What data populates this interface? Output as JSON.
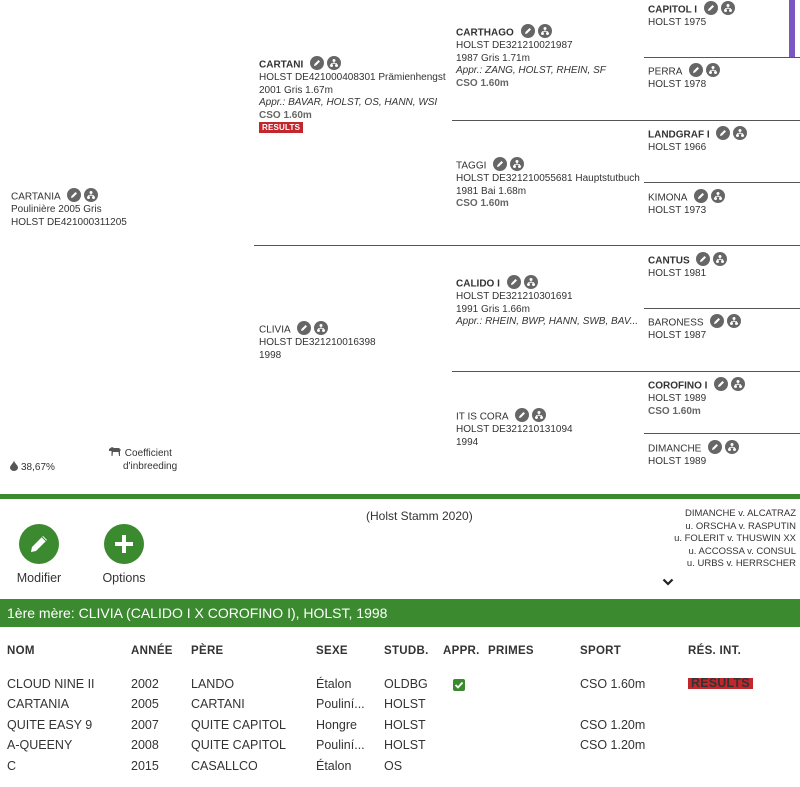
{
  "pedigree": {
    "gen1": {
      "name": "CARTANIA",
      "line1": "Poulinière 2005 Gris",
      "line2": "HOLST DE421000311205"
    },
    "gen2": [
      {
        "name": "CARTANI",
        "line1": "HOLST DE421000408301 Prämienhengst",
        "line2": "2001 Gris 1.67m",
        "appr": "Appr.: BAVAR, HOLST, OS, HANN, WSI",
        "sport": "CSO 1.60m",
        "badge": "RESULTS"
      },
      {
        "name": "CLIVIA",
        "line1": "HOLST DE321210016398",
        "line2": "1998"
      }
    ],
    "gen3": [
      {
        "name": "CARTHAGO",
        "line1": "HOLST DE321210021987",
        "line2": "1987 Gris 1.71m",
        "appr": "Appr.: ZANG, HOLST, RHEIN, SF",
        "sport": "CSO 1.60m"
      },
      {
        "name": "TAGGI",
        "line1": "HOLST DE321210055681 Hauptstutbuch",
        "line2": "1981 Bai 1.68m",
        "sport": "CSO 1.60m"
      },
      {
        "name": "CALIDO I",
        "line1": "HOLST DE321210301691",
        "line2": "1991 Gris 1.66m",
        "appr": "Appr.: RHEIN, BWP, HANN, SWB, BAV..."
      },
      {
        "name": "IT IS CORA",
        "line1": "HOLST DE321210131094",
        "line2": "1994"
      }
    ],
    "gen4": [
      {
        "name": "CAPITOL I",
        "line1": "HOLST 1975"
      },
      {
        "name": "PERRA",
        "line1": "HOLST 1978"
      },
      {
        "name": "LANDGRAF I",
        "line1": "HOLST 1966"
      },
      {
        "name": "KIMONA",
        "line1": "HOLST 1973"
      },
      {
        "name": "CANTUS",
        "line1": "HOLST 1981"
      },
      {
        "name": "BARONESS",
        "line1": "HOLST 1987"
      },
      {
        "name": "COROFINO I",
        "line1": "HOLST 1989",
        "sport": "CSO 1.60m"
      },
      {
        "name": "DIMANCHE",
        "line1": "HOLST 1989"
      }
    ],
    "inbreeding": {
      "percent": "38,67%",
      "label1": "Coefficient",
      "label2": "d'inbreeding"
    }
  },
  "actions": {
    "modify_label": "Modifier",
    "options_label": "Options"
  },
  "stamm": "(Holst Stamm 2020)",
  "lineage": [
    "DIMANCHE v. ALCATRAZ",
    "u. ORSCHA v. RASPUTIN",
    "u. FOLERIT v. THUSWIN XX",
    "u. ACCOSSA v. CONSUL",
    "u. URBS v. HERRSCHER"
  ],
  "mother_bar": "1ère mère: CLIVIA (CALIDO I X COROFINO I), HOLST, 1998",
  "table": {
    "headers": {
      "nom": "NOM",
      "annee": "ANNÉE",
      "pere": "PÈRE",
      "sexe": "SEXE",
      "studb": "STUDB.",
      "appr": "APPR.",
      "primes": "PRIMES",
      "sport": "SPORT",
      "res": "RÉS. INT."
    },
    "rows": [
      {
        "nom": "CLOUD NINE II",
        "annee": "2002",
        "pere": "LANDO",
        "sexe": "Étalon",
        "studb": "OLDBG",
        "appr": true,
        "sport": "CSO 1.60m",
        "res": "RESULTS"
      },
      {
        "nom": "CARTANIA",
        "annee": "2005",
        "pere": "CARTANI",
        "sexe": "Pouliní...",
        "studb": "HOLST",
        "appr": false,
        "sport": "",
        "res": ""
      },
      {
        "nom": "QUITE EASY 9",
        "annee": "2007",
        "pere": "QUITE CAPITOL",
        "sexe": "Hongre",
        "studb": "HOLST",
        "appr": false,
        "sport": "CSO 1.20m",
        "res": ""
      },
      {
        "nom": "A-QUEENY",
        "annee": "2008",
        "pere": "QUITE CAPITOL",
        "sexe": "Pouliní...",
        "studb": "HOLST",
        "appr": false,
        "sport": "CSO 1.20m",
        "res": ""
      },
      {
        "nom": "C",
        "annee": "2015",
        "pere": "CASALLCO",
        "sexe": "Étalon",
        "studb": "OS",
        "appr": false,
        "sport": "",
        "res": ""
      }
    ]
  }
}
